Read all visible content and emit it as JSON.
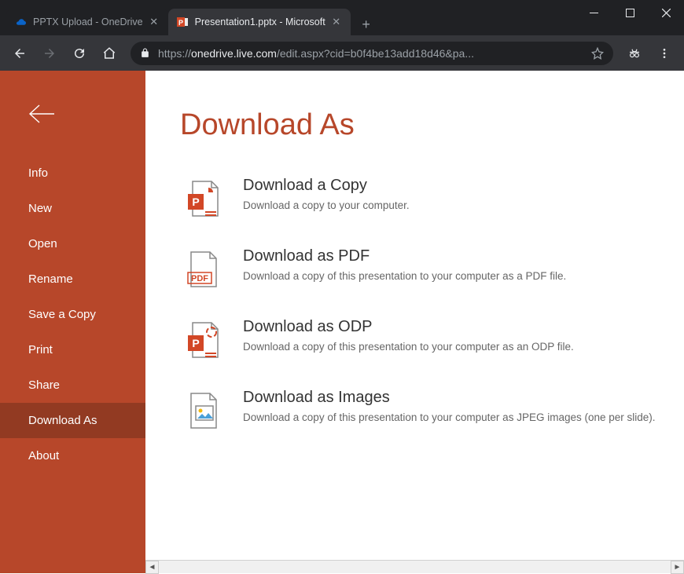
{
  "browser": {
    "tabs": [
      {
        "title": "PPTX Upload - OneDrive",
        "active": false
      },
      {
        "title": "Presentation1.pptx - Microsoft ",
        "active": true
      }
    ],
    "url_scheme": "https://",
    "url_host": "onedrive.live.com",
    "url_path": "/edit.aspx?cid=b0f4be13add18d46&pa..."
  },
  "sidebar": {
    "items": [
      {
        "label": "Info"
      },
      {
        "label": "New"
      },
      {
        "label": "Open"
      },
      {
        "label": "Rename"
      },
      {
        "label": "Save a Copy"
      },
      {
        "label": "Print"
      },
      {
        "label": "Share"
      },
      {
        "label": "Download As",
        "selected": true
      },
      {
        "label": "About"
      }
    ]
  },
  "page": {
    "title": "Download As",
    "options": [
      {
        "title": "Download a Copy",
        "desc": "Download a copy to your computer."
      },
      {
        "title": "Download as PDF",
        "desc": "Download a copy of this presentation to your computer as a PDF file."
      },
      {
        "title": "Download as ODP",
        "desc": "Download a copy of this presentation to your computer as an ODP file."
      },
      {
        "title": "Download as Images",
        "desc": "Download a copy of this presentation to your computer as JPEG images (one per slide)."
      }
    ]
  }
}
